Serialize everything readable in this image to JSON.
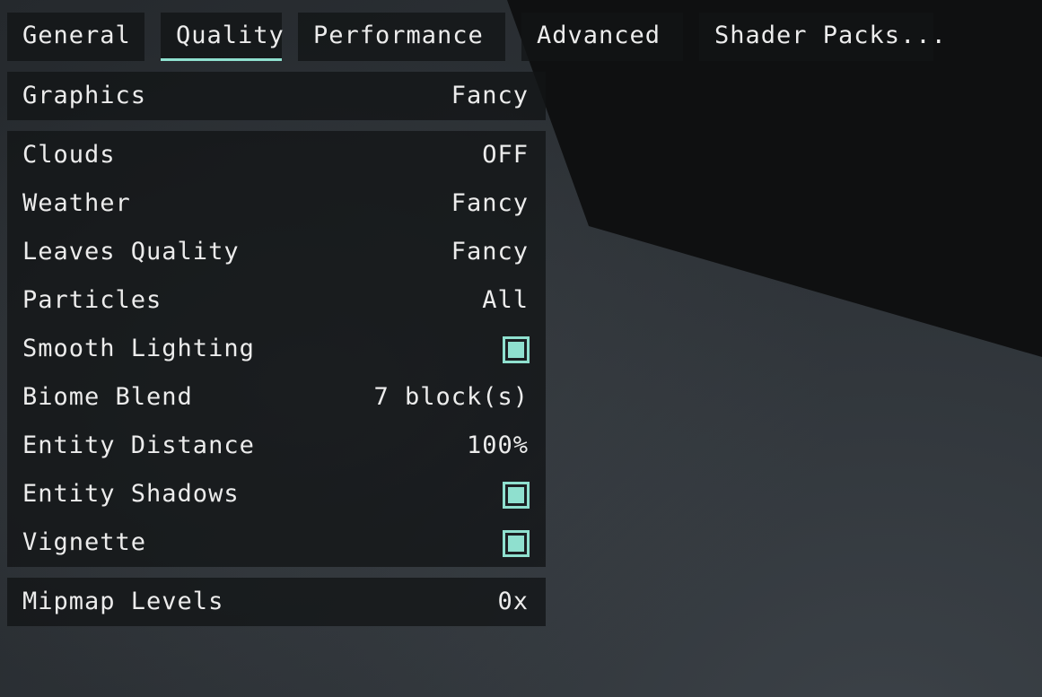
{
  "accent_color": "#8fe0cf",
  "tabs": [
    {
      "label": "General",
      "active": false
    },
    {
      "label": "Quality",
      "active": true
    },
    {
      "label": "Performance",
      "active": false
    },
    {
      "label": "Advanced",
      "active": false
    },
    {
      "label": "Shader Packs...",
      "active": false
    }
  ],
  "graphics": {
    "label": "Graphics",
    "value": "Fancy"
  },
  "settings": {
    "clouds": {
      "label": "Clouds",
      "value": "OFF"
    },
    "weather": {
      "label": "Weather",
      "value": "Fancy"
    },
    "leaves_quality": {
      "label": "Leaves Quality",
      "value": "Fancy"
    },
    "particles": {
      "label": "Particles",
      "value": "All"
    },
    "smooth_lighting": {
      "label": "Smooth Lighting",
      "checked": true
    },
    "biome_blend": {
      "label": "Biome Blend",
      "value": "7 block(s)"
    },
    "entity_distance": {
      "label": "Entity Distance",
      "value": "100%"
    },
    "entity_shadows": {
      "label": "Entity Shadows",
      "checked": true
    },
    "vignette": {
      "label": "Vignette",
      "checked": true
    }
  },
  "mipmap": {
    "label": "Mipmap Levels",
    "value": "0x"
  }
}
